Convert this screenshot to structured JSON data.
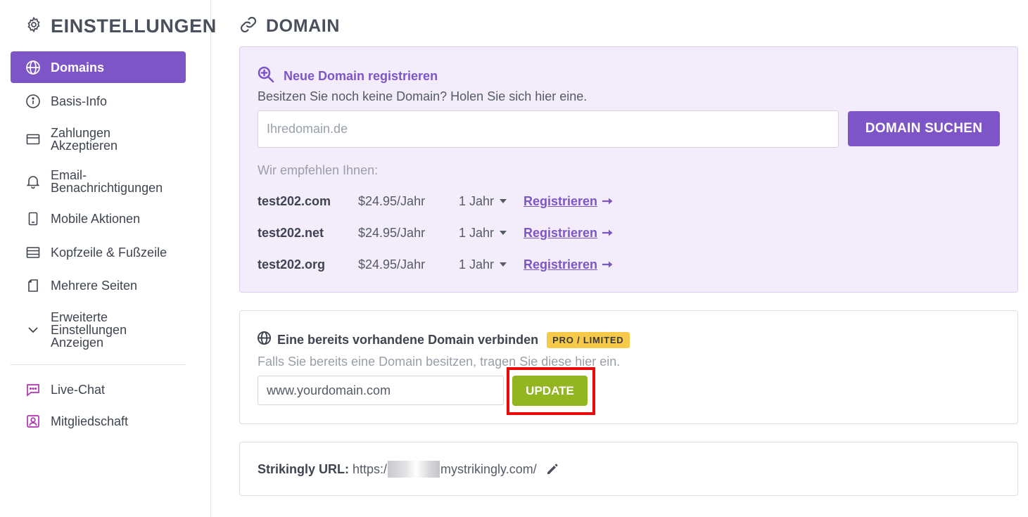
{
  "sidebar": {
    "title": "EINSTELLUNGEN",
    "items": [
      {
        "label": "Domains",
        "icon": "globe-icon"
      },
      {
        "label": "Basis-Info",
        "icon": "info-icon"
      },
      {
        "label": "Zahlungen\nAkzeptieren",
        "icon": "card-icon"
      },
      {
        "label": "Email-\nBenachrichtigungen",
        "icon": "bell-icon"
      },
      {
        "label": "Mobile Aktionen",
        "icon": "mobile-icon"
      },
      {
        "label": "Kopfzeile & Fußzeile",
        "icon": "layout-icon"
      },
      {
        "label": "Mehrere Seiten",
        "icon": "pages-icon"
      },
      {
        "label": "Erweiterte\nEinstellungen\nAnzeigen",
        "icon": "chevron-down-icon"
      },
      {
        "label": "Live-Chat",
        "icon": "chat-icon"
      },
      {
        "label": "Mitgliedschaft",
        "icon": "member-icon"
      }
    ]
  },
  "main": {
    "title": "DOMAIN",
    "new_domain": {
      "heading": "Neue Domain registrieren",
      "subtitle": "Besitzen Sie noch keine Domain? Holen Sie sich hier eine.",
      "input_placeholder": "Ihredomain.de",
      "search_button": "DOMAIN SUCHEN",
      "recommend_label": "Wir empfehlen Ihnen:",
      "recommendations": [
        {
          "domain": "test202.com",
          "price": "$24.95/Jahr",
          "term": "1 Jahr",
          "action": "Registrieren"
        },
        {
          "domain": "test202.net",
          "price": "$24.95/Jahr",
          "term": "1 Jahr",
          "action": "Registrieren"
        },
        {
          "domain": "test202.org",
          "price": "$24.95/Jahr",
          "term": "1 Jahr",
          "action": "Registrieren"
        }
      ]
    },
    "existing": {
      "heading": "Eine bereits vorhandene Domain verbinden",
      "badge": "PRO / LIMITED",
      "subtitle": "Falls Sie bereits eine Domain besitzen, tragen Sie diese hier ein.",
      "input_value": "www.yourdomain.com",
      "button": "UPDATE"
    },
    "url": {
      "label": "Strikingly URL:",
      "prefix": "https:/",
      "suffix": "mystrikingly.com/"
    }
  },
  "colors": {
    "accent": "#7d55c7",
    "purple_bg": "#f2ecfb",
    "green": "#93b520",
    "badge": "#f7c948",
    "highlight": "#ea0a0a"
  }
}
